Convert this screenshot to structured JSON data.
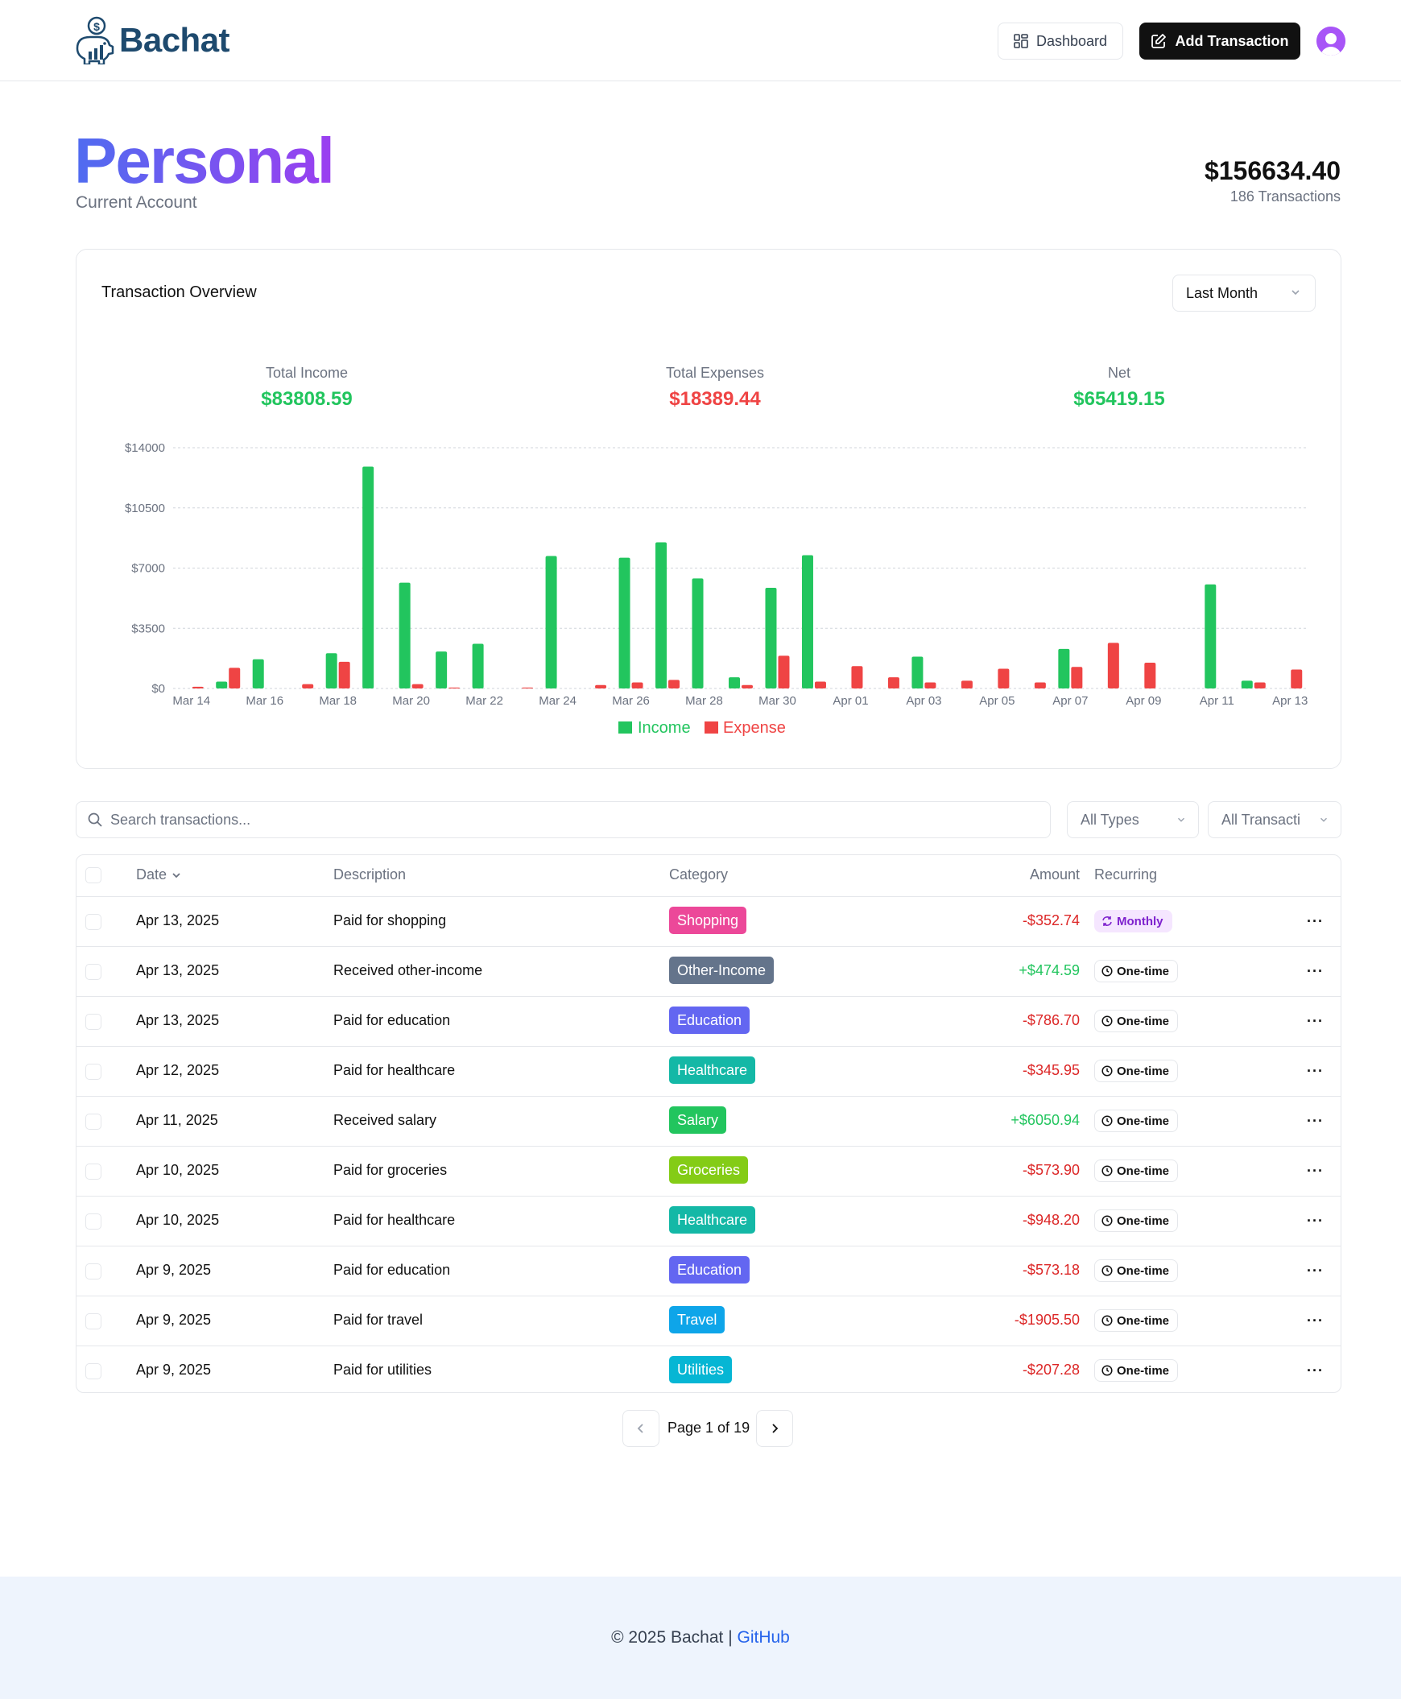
{
  "header": {
    "brand": "Bachat",
    "dashboard_label": "Dashboard",
    "add_label": "Add Transaction"
  },
  "account": {
    "name": "Personal",
    "type": "Current Account",
    "balance": "$156634.40",
    "transactions_count": "186 Transactions"
  },
  "overview": {
    "title": "Transaction Overview",
    "period": "Last Month",
    "stats": [
      {
        "label": "Total Income",
        "value": "$83808.59",
        "color": "#22c55e"
      },
      {
        "label": "Total Expenses",
        "value": "$18389.44",
        "color": "#ef4444"
      },
      {
        "label": "Net",
        "value": "$65419.15",
        "color": "#22c55e"
      }
    ]
  },
  "chart_data": {
    "type": "bar",
    "categories": [
      "Mar 14",
      "Mar 15",
      "Mar 16",
      "Mar 17",
      "Mar 18",
      "Mar 19",
      "Mar 20",
      "Mar 21",
      "Mar 22",
      "Mar 23",
      "Mar 24",
      "Mar 25",
      "Mar 26",
      "Mar 27",
      "Mar 28",
      "Mar 29",
      "Mar 30",
      "Mar 31",
      "Apr 01",
      "Apr 02",
      "Apr 03",
      "Apr 04",
      "Apr 05",
      "Apr 06",
      "Apr 07",
      "Apr 08",
      "Apr 09",
      "Apr 10",
      "Apr 11",
      "Apr 12",
      "Apr 13"
    ],
    "tick_labels": [
      "Mar 14",
      "Mar 16",
      "Mar 18",
      "Mar 20",
      "Mar 22",
      "Mar 24",
      "Mar 26",
      "Mar 28",
      "Mar 30",
      "Apr 01",
      "Apr 03",
      "Apr 05",
      "Apr 07",
      "Apr 09",
      "Apr 11",
      "Apr 13"
    ],
    "series": [
      {
        "name": "Income",
        "color": "#22c55e",
        "values": [
          0,
          400,
          1700,
          0,
          2050,
          12900,
          6150,
          2150,
          2600,
          0,
          7700,
          0,
          7600,
          8500,
          6400,
          650,
          5850,
          7750,
          0,
          0,
          1850,
          0,
          0,
          0,
          2300,
          0,
          0,
          0,
          6050,
          450,
          0
        ]
      },
      {
        "name": "Expense",
        "color": "#ef4444",
        "values": [
          100,
          1200,
          0,
          250,
          1550,
          0,
          250,
          50,
          0,
          50,
          0,
          200,
          350,
          500,
          0,
          200,
          1900,
          400,
          1300,
          650,
          350,
          450,
          1150,
          350,
          1250,
          2650,
          1500,
          0,
          0,
          350,
          1100
        ]
      }
    ],
    "y_ticks": [
      "$0",
      "$3500",
      "$7000",
      "$10500",
      "$14000"
    ],
    "ylim": [
      0,
      14000
    ],
    "grid": true,
    "legend": "bottom-center"
  },
  "search": {
    "placeholder": "Search transactions..."
  },
  "filters": {
    "type": "All Types",
    "scope": "All Transacti"
  },
  "table": {
    "columns": {
      "date": "Date",
      "description": "Description",
      "category": "Category",
      "amount": "Amount",
      "recurring": "Recurring"
    },
    "rows": [
      {
        "date": "Apr 13, 2025",
        "description": "Paid for shopping",
        "category": "Shopping",
        "category_color": "#ec4899",
        "amount": "-$352.74",
        "kind": "expense",
        "recurring": "Monthly",
        "monthly": true
      },
      {
        "date": "Apr 13, 2025",
        "description": "Received other-income",
        "category": "Other-Income",
        "category_color": "#64748b",
        "amount": "+$474.59",
        "kind": "income",
        "recurring": "One-time",
        "monthly": false
      },
      {
        "date": "Apr 13, 2025",
        "description": "Paid for education",
        "category": "Education",
        "category_color": "#6366f1",
        "amount": "-$786.70",
        "kind": "expense",
        "recurring": "One-time",
        "monthly": false
      },
      {
        "date": "Apr 12, 2025",
        "description": "Paid for healthcare",
        "category": "Healthcare",
        "category_color": "#14b8a6",
        "amount": "-$345.95",
        "kind": "expense",
        "recurring": "One-time",
        "monthly": false
      },
      {
        "date": "Apr 11, 2025",
        "description": "Received salary",
        "category": "Salary",
        "category_color": "#22c55e",
        "amount": "+$6050.94",
        "kind": "income",
        "recurring": "One-time",
        "monthly": false
      },
      {
        "date": "Apr 10, 2025",
        "description": "Paid for groceries",
        "category": "Groceries",
        "category_color": "#84cc16",
        "amount": "-$573.90",
        "kind": "expense",
        "recurring": "One-time",
        "monthly": false
      },
      {
        "date": "Apr 10, 2025",
        "description": "Paid for healthcare",
        "category": "Healthcare",
        "category_color": "#14b8a6",
        "amount": "-$948.20",
        "kind": "expense",
        "recurring": "One-time",
        "monthly": false
      },
      {
        "date": "Apr 9, 2025",
        "description": "Paid for education",
        "category": "Education",
        "category_color": "#6366f1",
        "amount": "-$573.18",
        "kind": "expense",
        "recurring": "One-time",
        "monthly": false
      },
      {
        "date": "Apr 9, 2025",
        "description": "Paid for travel",
        "category": "Travel",
        "category_color": "#0ea5e9",
        "amount": "-$1905.50",
        "kind": "expense",
        "recurring": "One-time",
        "monthly": false
      },
      {
        "date": "Apr 9, 2025",
        "description": "Paid for utilities",
        "category": "Utilities",
        "category_color": "#06b6d4",
        "amount": "-$207.28",
        "kind": "expense",
        "recurring": "One-time",
        "monthly": false
      }
    ]
  },
  "pagination": {
    "label": "Page 1 of 19"
  },
  "footer": {
    "copyright": "© 2025 Bachat |",
    "link": "GitHub"
  }
}
